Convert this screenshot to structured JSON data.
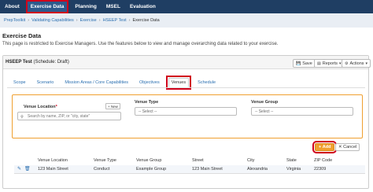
{
  "nav": {
    "items": [
      {
        "label": "About",
        "active": false
      },
      {
        "label": "Exercise Data",
        "active": true
      },
      {
        "label": "Planning",
        "active": false
      },
      {
        "label": "MSEL",
        "active": false
      },
      {
        "label": "Evaluation",
        "active": false
      }
    ],
    "bg_color": "#1f3e63"
  },
  "breadcrumb": [
    "PrepToolkit",
    "Validating Capabilities",
    "Exercise",
    "HSEEP Test",
    "Exercise Data"
  ],
  "page": {
    "title": "Exercise Data",
    "description": "This page is restricted to Exercise Managers. Use the features below to view and manage overarching data related to your exercise."
  },
  "panel": {
    "exercise_name": "HSEEP Test",
    "schedule_status": "(Schedule: Draft)",
    "buttons": {
      "save": "Save",
      "reports": "Reports",
      "actions": "Actions"
    }
  },
  "tabs": [
    {
      "label": "Scope",
      "active": false
    },
    {
      "label": "Scenario",
      "active": false
    },
    {
      "label": "Mission Areas / Core Capabilities",
      "active": false
    },
    {
      "label": "Objectives",
      "active": false
    },
    {
      "label": "Venues",
      "active": true
    },
    {
      "label": "Schedule",
      "active": false
    }
  ],
  "filters": {
    "venue_location_label": "Venue Location",
    "required_mark": "*",
    "new_button": "+ New",
    "venue_location_placeholder": "Search by name, ZIP, or \"city, state\"",
    "venue_type_label": "Venue Type",
    "venue_type_value": "-- Select --",
    "venue_group_label": "Venue Group",
    "venue_group_value": "-- Select --"
  },
  "actions": {
    "add": "Add",
    "cancel": "Cancel",
    "accent_color": "#f0a030"
  },
  "table": {
    "columns": [
      "Venue Location",
      "Venue Type",
      "Venue Group",
      "Street",
      "City",
      "State",
      "ZIP Code"
    ],
    "rows": [
      [
        "123 Main Street",
        "Conduct",
        "Example Group",
        "123 Main Street",
        "Alexandria",
        "Virginia",
        "22309"
      ]
    ]
  }
}
